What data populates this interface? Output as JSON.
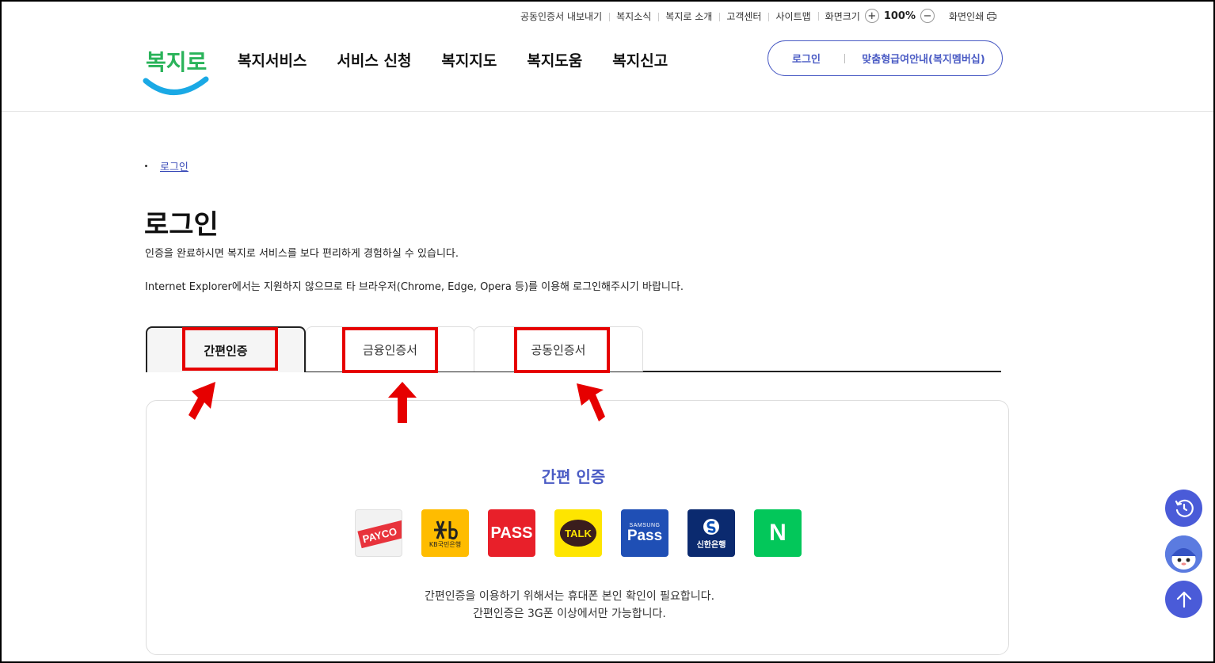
{
  "utility": {
    "links": [
      "공동인증서 내보내기",
      "복지소식",
      "복지로 소개",
      "고객센터",
      "사이트맵"
    ],
    "zoom_label": "화면크기",
    "zoom_in": "+",
    "zoom_value": "100%",
    "zoom_out": "−",
    "print_label": "화면인쇄"
  },
  "header": {
    "logo_text": "복지로",
    "nav": [
      "복지서비스",
      "서비스 신청",
      "복지지도",
      "복지도움",
      "복지신고"
    ],
    "login_label": "로그인",
    "membership_label": "맞춤형급여안내(복지멤버십)"
  },
  "breadcrumb": {
    "current": "로그인"
  },
  "page": {
    "title": "로그인",
    "description": "인증을 완료하시면 복지로 서비스를 보다 편리하게 경험하실 수 있습니다.",
    "browser_notice": "Internet Explorer에서는 지원하지 않으므로 타 브라우저(Chrome, Edge, Opera 등)를 이용해 로그인해주시기 바랍니다."
  },
  "tabs": [
    {
      "label": "간편인증",
      "active": true
    },
    {
      "label": "금융인증서",
      "active": false
    },
    {
      "label": "공동인증서",
      "active": false
    }
  ],
  "panel": {
    "title": "간편 인증",
    "providers": [
      {
        "name": "payco-icon",
        "label": "PAYCO",
        "color": "#e8333c"
      },
      {
        "name": "kb-bank-icon",
        "label": "KB국민은행",
        "color": "#ffbc00"
      },
      {
        "name": "pass-icon",
        "label": "PASS",
        "color": "#e8202a"
      },
      {
        "name": "kakao-talk-icon",
        "label": "TALK",
        "color": "#fee500"
      },
      {
        "name": "samsung-pass-icon",
        "label": "Pass",
        "sublabel": "SAMSUNG",
        "color": "#1f4fb5"
      },
      {
        "name": "shinhan-bank-icon",
        "label": "신한은행",
        "color": "#0b2a6f"
      },
      {
        "name": "naver-icon",
        "label": "N",
        "color": "#03c75a"
      }
    ],
    "message_line1": "간편인증을 이용하기 위해서는 휴대폰 본인 확인이 필요합니다.",
    "message_line2": "간편인증은 3G폰 이상에서만 가능합니다."
  },
  "colors": {
    "accent": "#4a5bc4",
    "highlight": "#e60000",
    "fab": "#4a5bd8"
  }
}
